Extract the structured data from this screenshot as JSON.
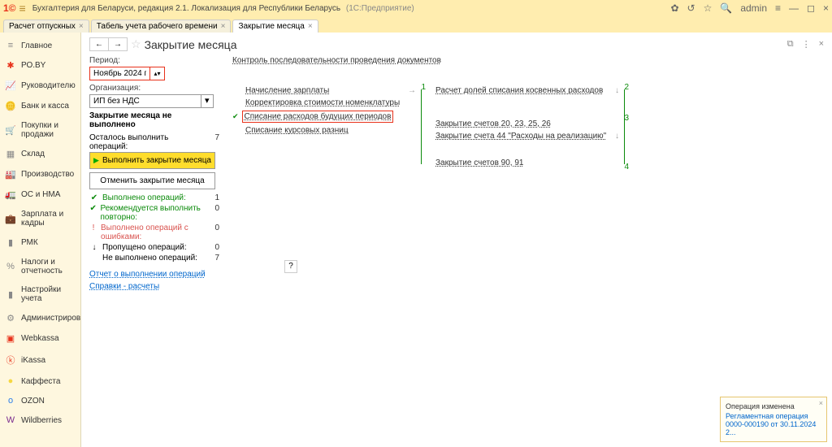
{
  "header": {
    "title": "Бухгалтерия для Беларуси, редакция 2.1. Локализация для Республики Беларусь",
    "system": "(1С:Предприятие)",
    "user": "admin"
  },
  "tabs": [
    {
      "label": "Расчет отпускных"
    },
    {
      "label": "Табель учета рабочего времени"
    },
    {
      "label": "Закрытие месяца"
    }
  ],
  "sidebar": [
    {
      "icon": "≡",
      "label": "Главное",
      "color": "#888"
    },
    {
      "icon": "✱",
      "label": "РО.BY",
      "color": "#e8311a"
    },
    {
      "icon": "📈",
      "label": "Руководителю",
      "color": "#888"
    },
    {
      "icon": "🪙",
      "label": "Банк и касса",
      "color": "#888"
    },
    {
      "icon": "🛒",
      "label": "Покупки и продажи",
      "color": "#888"
    },
    {
      "icon": "▦",
      "label": "Склад",
      "color": "#888"
    },
    {
      "icon": "🏭",
      "label": "Производство",
      "color": "#888"
    },
    {
      "icon": "🚛",
      "label": "ОС и НМА",
      "color": "#888"
    },
    {
      "icon": "💼",
      "label": "Зарплата и кадры",
      "color": "#888"
    },
    {
      "icon": "▮",
      "label": "РМК",
      "color": "#888"
    },
    {
      "icon": "%",
      "label": "Налоги и отчетность",
      "color": "#888"
    },
    {
      "icon": "▮",
      "label": "Настройки учета",
      "color": "#888"
    },
    {
      "icon": "⚙",
      "label": "Администрирование",
      "color": "#888"
    },
    {
      "icon": "▣",
      "label": "Webkassa",
      "color": "#e8311a"
    },
    {
      "icon": "ⓚ",
      "label": "iKassa",
      "color": "#e8311a"
    },
    {
      "icon": "●",
      "label": "Каффеста",
      "color": "#f5d742"
    },
    {
      "icon": "o",
      "label": "OZON",
      "color": "#2b7de9"
    },
    {
      "icon": "W",
      "label": "Wildberries",
      "color": "#7b2d8e"
    }
  ],
  "page": {
    "title": "Закрытие месяца",
    "period_label": "Период:",
    "period_value": "Ноябрь 2024 г.",
    "org_label": "Организация:",
    "org_value": "ИП без НДС",
    "not_done": "Закрытие месяца не выполнено",
    "pending_label": "Осталось выполнить операций:",
    "pending_count": "7",
    "btn_exec": "Выполнить закрытие месяца",
    "btn_cancel": "Отменить закрытие месяца",
    "status": [
      {
        "icon": "✔",
        "label": "Выполнено операций:",
        "val": "1",
        "cls": "green"
      },
      {
        "icon": "✔",
        "label": "Рекомендуется выполнить повторно:",
        "val": "0",
        "cls": "green"
      },
      {
        "icon": "!",
        "label": "Выполнено операций с ошибками:",
        "val": "0",
        "cls": "red"
      },
      {
        "icon": "↓",
        "label": "Пропущено операций:",
        "val": "0",
        "cls": ""
      },
      {
        "icon": "",
        "label": "Не выполнено операций:",
        "val": "7",
        "cls": ""
      }
    ],
    "report_link": "Отчет о выполнении операций",
    "help_link": "Справки - расчеты",
    "top_link": "Контроль последовательности проведения документов"
  },
  "stages": {
    "col1": [
      {
        "label": "Начисление зарплаты"
      },
      {
        "label": "Корректировка стоимости номенклатуры"
      },
      {
        "label": "Списание расходов будущих периодов",
        "hl": true
      },
      {
        "label": "Списание курсовых разниц"
      }
    ],
    "col2": [
      {
        "label": "Расчет долей списания косвенных расходов"
      }
    ],
    "col3": [
      {
        "label": "Закрытие счетов 20, 23, 25, 26"
      },
      {
        "label": "Закрытие счета 44 \"Расходы на реализацию\""
      }
    ],
    "col4": [
      {
        "label": "Закрытие счетов 90, 91"
      }
    ]
  },
  "notif": {
    "title": "Операция изменена",
    "line1": "Регламентная операция",
    "line2": "0000-000190 от 30.11.2024 2..."
  }
}
